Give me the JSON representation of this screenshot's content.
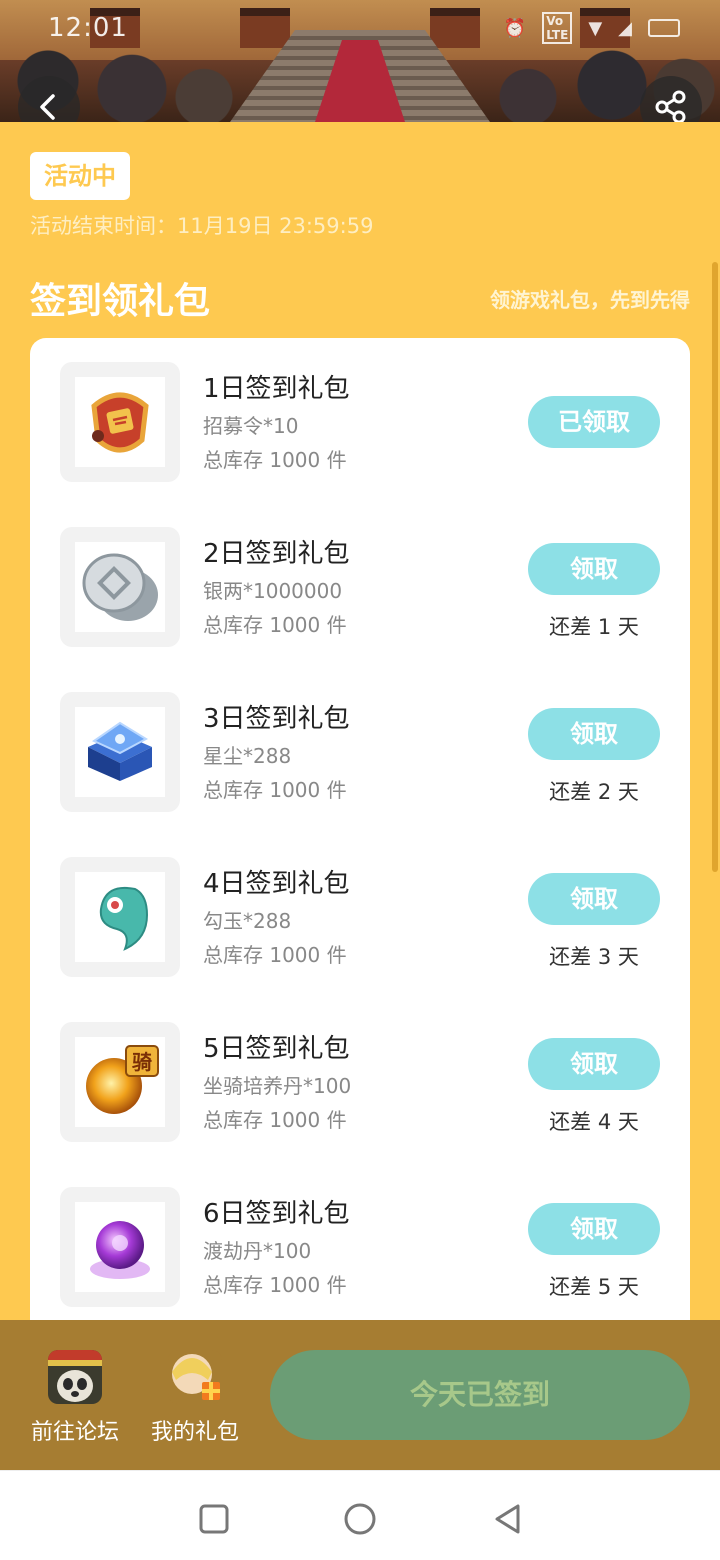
{
  "status_bar": {
    "time": "12:01"
  },
  "banner": {
    "back_icon": "chevron-left-icon",
    "share_icon": "share-icon"
  },
  "activity": {
    "status": "活动中",
    "end_time": "活动结束时间：11月19日 23:59:59"
  },
  "section": {
    "title": "签到领礼包",
    "subtitle": "领游戏礼包，先到先得"
  },
  "colors": {
    "page_bg": "#fec950",
    "button": "#8de0e6",
    "bottom_bar": "#a67d32",
    "signin_button": "#6b9d75"
  },
  "gifts": [
    {
      "title": "1日签到礼包",
      "item": "招募令*10",
      "stock": "总库存 1000 件",
      "button": "已领取",
      "remain": "",
      "icon": "recruit-token-icon"
    },
    {
      "title": "2日签到礼包",
      "item": "银两*1000000",
      "stock": "总库存 1000 件",
      "button": "领取",
      "remain": "还差 1 天",
      "icon": "silver-coin-icon"
    },
    {
      "title": "3日签到礼包",
      "item": "星尘*288",
      "stock": "总库存 1000 件",
      "button": "领取",
      "remain": "还差 2 天",
      "icon": "stardust-chest-icon"
    },
    {
      "title": "4日签到礼包",
      "item": "勾玉*288",
      "stock": "总库存 1000 件",
      "button": "领取",
      "remain": "还差 3 天",
      "icon": "magatama-icon"
    },
    {
      "title": "5日签到礼包",
      "item": "坐骑培养丹*100",
      "stock": "总库存 1000 件",
      "button": "领取",
      "remain": "还差 4 天",
      "icon": "mount-pill-icon"
    },
    {
      "title": "6日签到礼包",
      "item": "渡劫丹*100",
      "stock": "总库存 1000 件",
      "button": "领取",
      "remain": "还差 5 天",
      "icon": "tribulation-pill-icon"
    }
  ],
  "bottom": {
    "forum_label": "前往论坛",
    "my_gifts_label": "我的礼包",
    "signin_label": "今天已签到"
  }
}
